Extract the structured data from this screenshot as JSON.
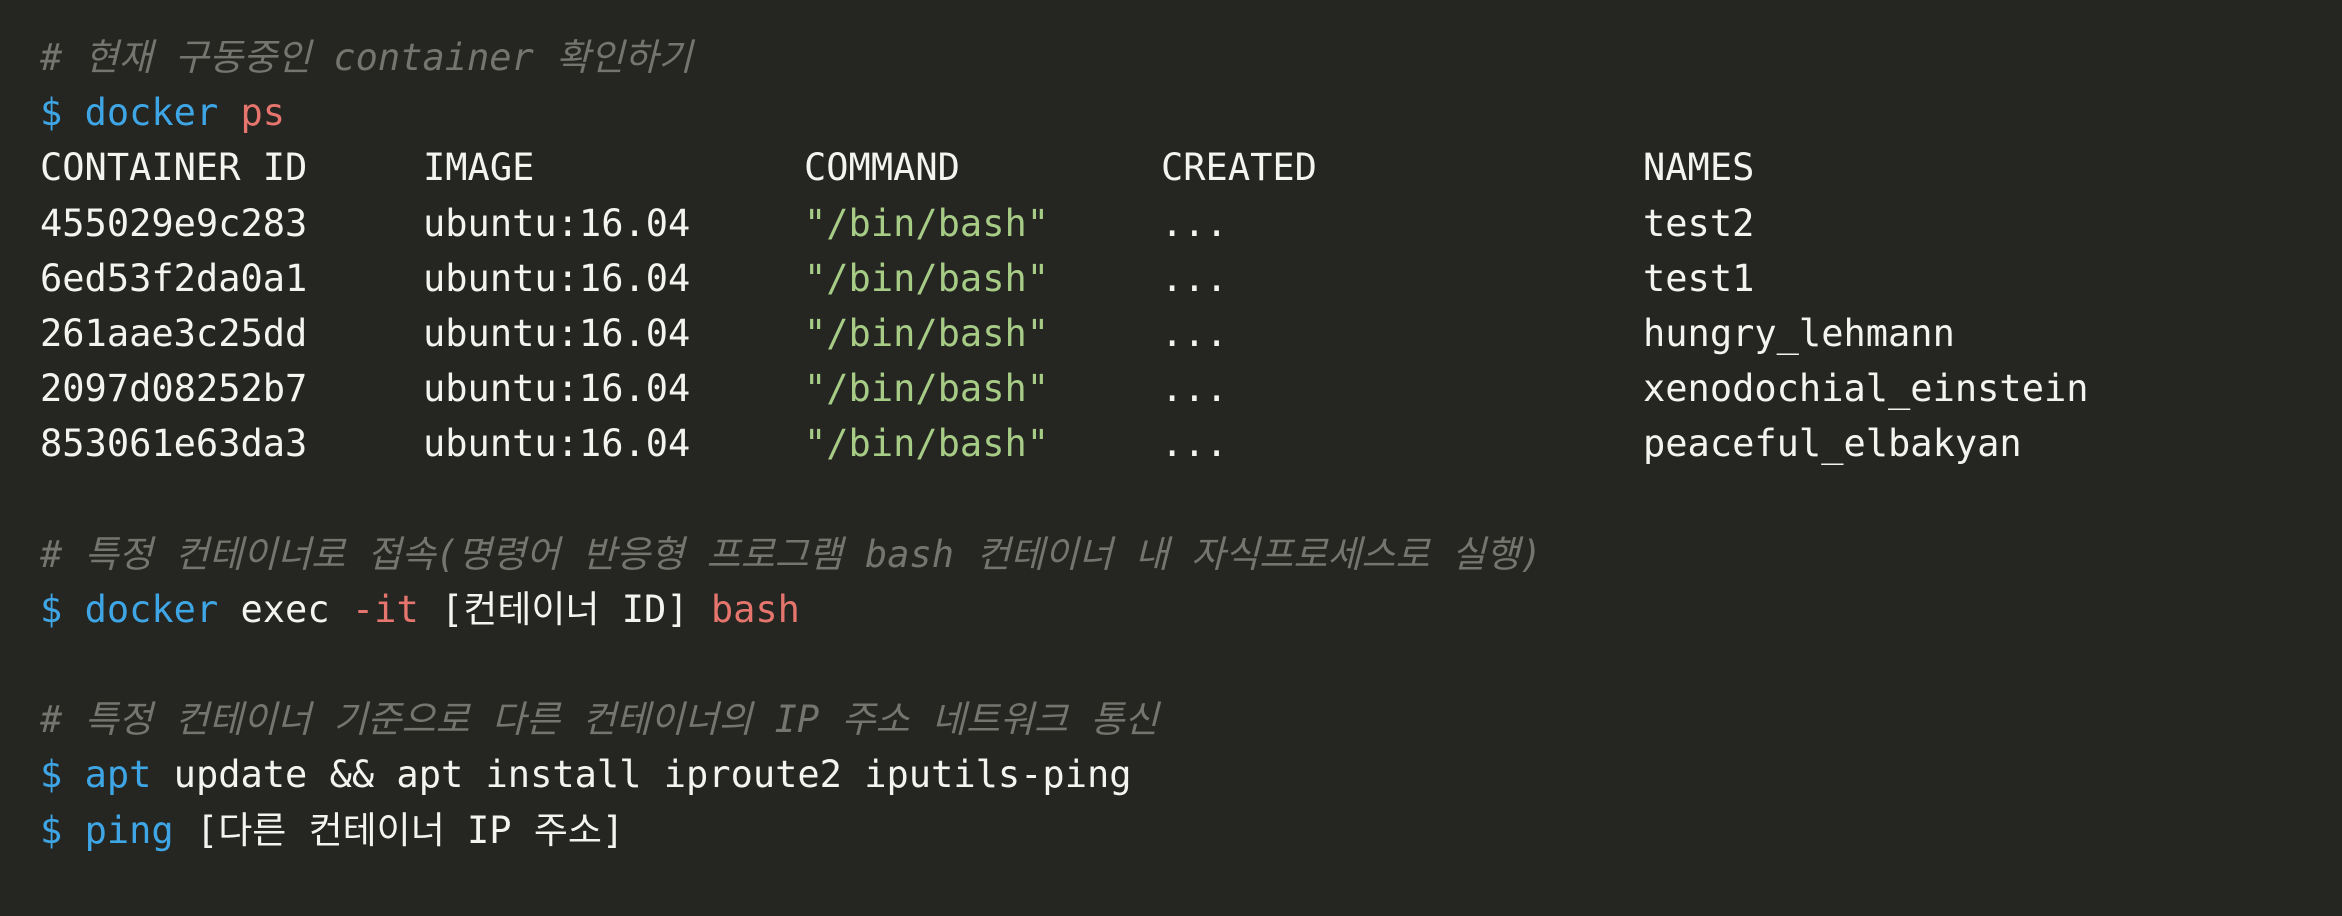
{
  "comments": {
    "check_running": "# 현재 구동중인 container 확인하기",
    "exec_into": "# 특정 컨테이너로 접속(명령어 반응형 프로그램 bash 컨테이너 내 자식프로세스로 실행)",
    "network": "# 특정 컨테이너 기준으로 다른 컨테이너의 IP 주소 네트워크 통신"
  },
  "prompt": "$",
  "cmd_ps": {
    "bin": "docker",
    "arg": "ps"
  },
  "table": {
    "headers": [
      "CONTAINER ID",
      "IMAGE",
      "COMMAND",
      "CREATED",
      "NAMES"
    ],
    "rows": [
      {
        "id": "455029e9c283",
        "image": "ubuntu:16.04",
        "command": "\"/bin/bash\"",
        "created": "...",
        "name": "test2"
      },
      {
        "id": "6ed53f2da0a1",
        "image": "ubuntu:16.04",
        "command": "\"/bin/bash\"",
        "created": "...",
        "name": "test1"
      },
      {
        "id": "261aae3c25dd",
        "image": "ubuntu:16.04",
        "command": "\"/bin/bash\"",
        "created": "...",
        "name": "hungry_lehmann"
      },
      {
        "id": "2097d08252b7",
        "image": "ubuntu:16.04",
        "command": "\"/bin/bash\"",
        "created": "...",
        "name": "xenodochial_einstein"
      },
      {
        "id": "853061e63da3",
        "image": "ubuntu:16.04",
        "command": "\"/bin/bash\"",
        "created": "...",
        "name": "peaceful_elbakyan"
      }
    ]
  },
  "cmd_exec": {
    "bin": "docker",
    "sub": "exec",
    "flag": "-it",
    "target": "[컨테이너 ID]",
    "shell": "bash"
  },
  "cmd_apt": {
    "bin": "apt",
    "rest": "update && apt install iproute2 iputils-ping"
  },
  "cmd_ping": {
    "bin": "ping",
    "target": "[다른 컨테이너 IP 주소]"
  },
  "colors": {
    "background": "#252522",
    "comment": "#757570",
    "command": "#3fa6e6",
    "argument": "#e5756d",
    "string": "#a6cc86",
    "text": "#f3f3ef"
  }
}
